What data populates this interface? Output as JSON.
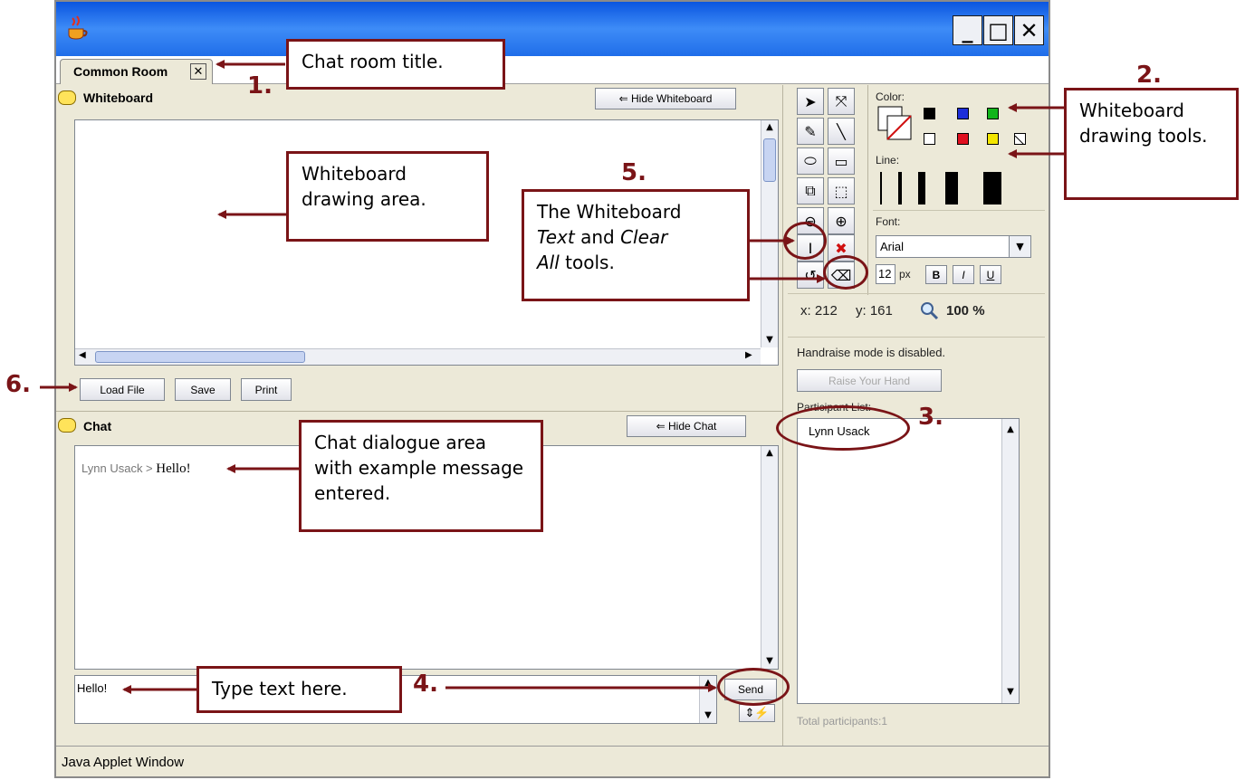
{
  "window": {
    "minimize": "_",
    "maximize": "□",
    "close": "✕",
    "status_bar": "Java Applet Window"
  },
  "tab": {
    "title": "Common Room",
    "close": "✕"
  },
  "whiteboard": {
    "title": "Whiteboard",
    "hide_button": "⇐ Hide Whiteboard",
    "load_button": "Load File",
    "save_button": "Save",
    "print_button": "Print"
  },
  "tools": {
    "color_label": "Color:",
    "line_label": "Line:",
    "font_label": "Font:",
    "font_value": "Arial",
    "size_value": "12",
    "size_unit": "px",
    "bold": "B",
    "italic": "I",
    "underline": "U",
    "coord_x": "x: 212",
    "coord_y": "y: 161",
    "zoom": "100 %",
    "colors": [
      "#000000",
      "#1e2fd9",
      "#12b51b",
      "#ffffff",
      "#e01020",
      "#f3e600"
    ]
  },
  "handraise": {
    "status": "Handraise mode is disabled.",
    "button": "Raise Your Hand"
  },
  "participants": {
    "label": "Participant List:",
    "items": [
      "Lynn Usack"
    ],
    "total": "Total participants:1"
  },
  "chat": {
    "title": "Chat",
    "hide_button": "⇐ Hide Chat",
    "message_user": "Lynn Usack",
    "message_sep": " > ",
    "message_text": "Hello!",
    "input_value": "Hello!",
    "send_button": "Send"
  },
  "annotations": {
    "n1": "1.",
    "n2": "2.",
    "n3": "3.",
    "n4": "4.",
    "n5": "5.",
    "n6": "6.",
    "c1": "Chat room title.",
    "c2": "Whiteboard drawing tools.",
    "c3": "Whiteboard drawing area.",
    "c5a": "The Whiteboard",
    "c5b_em1": "Text",
    "c5b_mid": " and ",
    "c5b_em2": "Clear",
    "c5c_em": "All",
    "c5c_rest": " tools.",
    "c6": "Chat dialogue area with example message entered.",
    "c7": "Type text here.",
    "accent": "#7a1417"
  }
}
